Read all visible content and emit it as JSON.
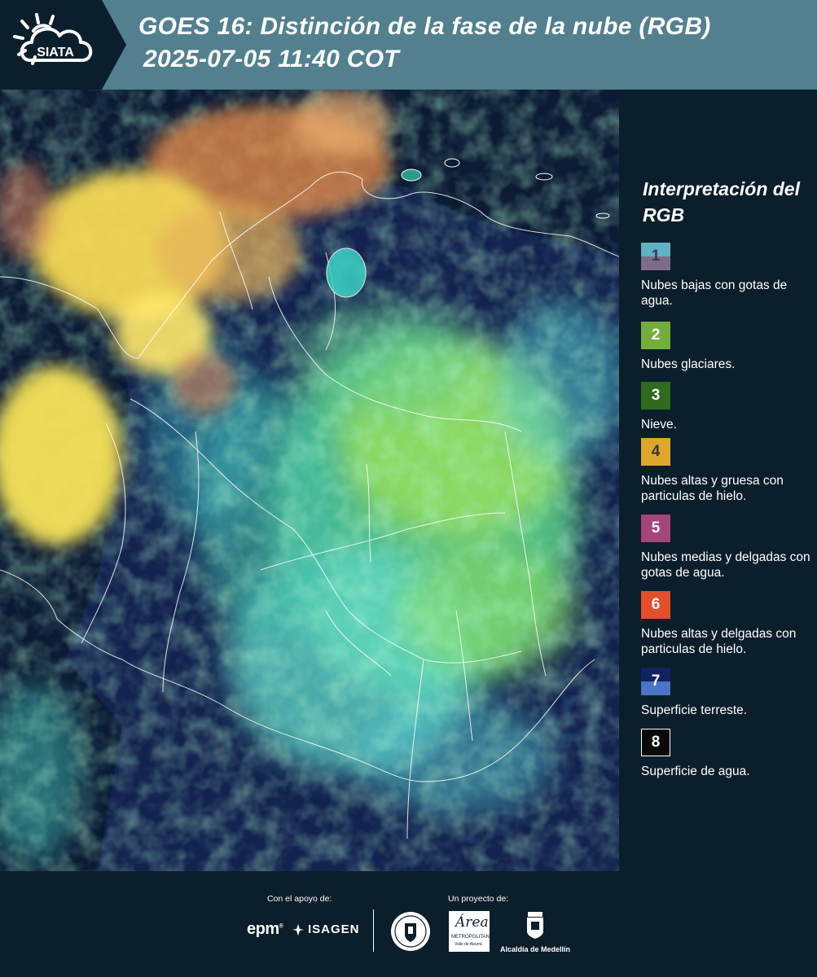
{
  "header": {
    "logo_text": "SIATA",
    "title_line1": "GOES 16: Distinción de la fase de la nube (RGB)",
    "title_line2": "2025-07-05 11:40 COT",
    "background_color": "#52808f",
    "logo_background_color": "#0b1e2b"
  },
  "legend": {
    "title": "Interpretación del RGB",
    "items": [
      {
        "number": "1",
        "description": "Nubes bajas con gotas de agua.",
        "color_top": "#5fb2c3",
        "color_bottom": "#7b6d87",
        "text_color": "#3a3a50"
      },
      {
        "number": "2",
        "description": "Nubes glaciares.",
        "color": "#72ae3a",
        "text_color": "#ffffff"
      },
      {
        "number": "3",
        "description": "Nieve.",
        "color": "#2f6a1e",
        "text_color": "#ffffff"
      },
      {
        "number": "4",
        "description": "Nubes altas y gruesa con particulas de hielo.",
        "color": "#dfa72a",
        "text_color": "#333333"
      },
      {
        "number": "5",
        "description": "Nubes medias y delgadas con gotas de agua.",
        "color": "#a5457a",
        "text_color": "#ffffff"
      },
      {
        "number": "6",
        "description": "Nubes altas y delgadas con particulas de hielo.",
        "color": "#e44e2b",
        "text_color": "#ffffff"
      },
      {
        "number": "7",
        "description": "Superficie terreste.",
        "color_top": "#0f2361",
        "color_bottom": "#4a74c5",
        "text_color": "#ffffff"
      },
      {
        "number": "8",
        "description": "Superficie de agua.",
        "color": "#0a0a0a",
        "border_color": "#ffffff",
        "text_color": "#ffffff"
      }
    ]
  },
  "footer": {
    "support_label": "Con el apoyo de:",
    "project_label": "Un proyecto de:",
    "sponsors": [
      "epm",
      "ISAGEN"
    ],
    "partners": {
      "amva_script": "Área",
      "amva_line1": "METROPOLITANA",
      "amva_line2": "Valle de Aburrá",
      "alcaldia": "Alcaldía de Medellín"
    }
  },
  "colors": {
    "page_background": "#0b1e2b",
    "ocean": "#0c1a33",
    "land": "#13224e",
    "cloud_yellow": "#f5e040",
    "cloud_green": "#7fe87a",
    "cloud_cyan": "#6ad7dc",
    "border_lines": "#ffffff"
  }
}
